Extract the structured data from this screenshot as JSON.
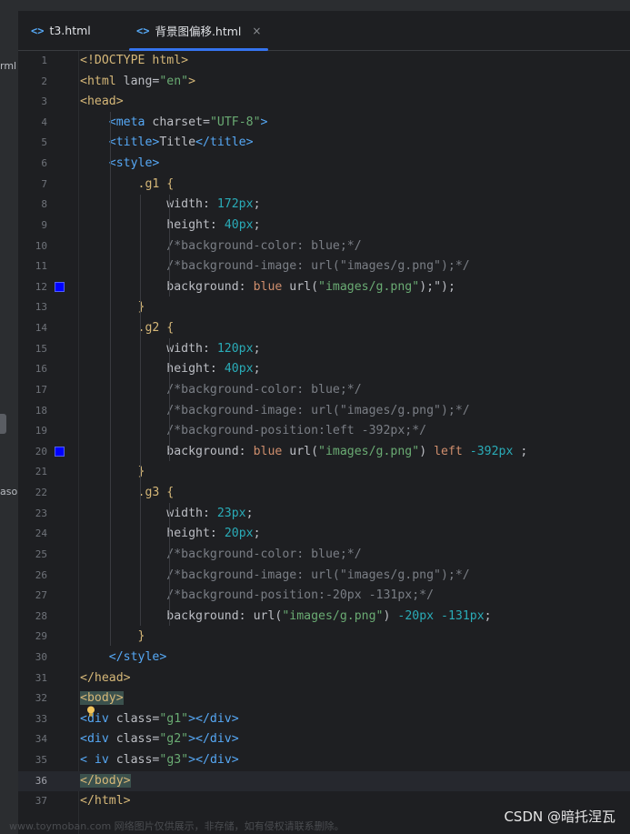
{
  "tabs": [
    {
      "label": "t3.html",
      "icon": "html-file-icon",
      "active": false
    },
    {
      "label": "背景图偏移.html",
      "icon": "html-file-icon",
      "active": true,
      "close": "×"
    }
  ],
  "tab_icon_glyph": "<>",
  "left_fragments": [
    "rml",
    "aso"
  ],
  "code_lines": [
    [
      [
        "t-tag",
        "<!DOCTYPE html>"
      ]
    ],
    [
      [
        "t-tag",
        "<html "
      ],
      [
        "t-attr",
        "lang="
      ],
      [
        "t-str",
        "\"en\""
      ],
      [
        "t-tag",
        ">"
      ]
    ],
    [
      [
        "t-tag",
        "<head>"
      ]
    ],
    [
      [
        "t-plain",
        "    "
      ],
      [
        "t-innertag",
        "<meta "
      ],
      [
        "t-attr",
        "charset="
      ],
      [
        "t-str",
        "\"UTF-8\""
      ],
      [
        "t-innertag",
        ">"
      ]
    ],
    [
      [
        "t-plain",
        "    "
      ],
      [
        "t-innertag",
        "<title>"
      ],
      [
        "t-plain",
        "Title"
      ],
      [
        "t-innertag",
        "</title>"
      ]
    ],
    [
      [
        "t-plain",
        "    "
      ],
      [
        "t-innertag",
        "<style>"
      ]
    ],
    [
      [
        "t-plain",
        "        "
      ],
      [
        "t-sel",
        ".g1 "
      ],
      [
        "t-brace",
        "{"
      ]
    ],
    [
      [
        "t-plain",
        "            "
      ],
      [
        "t-prop",
        "width: "
      ],
      [
        "t-num",
        "172px"
      ],
      [
        "t-plain",
        ";"
      ]
    ],
    [
      [
        "t-plain",
        "            "
      ],
      [
        "t-prop",
        "height: "
      ],
      [
        "t-num",
        "40px"
      ],
      [
        "t-plain",
        ";"
      ]
    ],
    [
      [
        "t-plain",
        "            "
      ],
      [
        "t-cmt",
        "/*background-color: blue;*/"
      ]
    ],
    [
      [
        "t-plain",
        "            "
      ],
      [
        "t-cmt",
        "/*background-image: url(\"images/g.png\");*/"
      ]
    ],
    [
      [
        "t-plain",
        "            "
      ],
      [
        "t-prop",
        "background: "
      ],
      [
        "t-kw",
        "blue "
      ],
      [
        "t-plain",
        "url("
      ],
      [
        "t-str",
        "\"images/g.png\""
      ],
      [
        "t-plain",
        ");\");"
      ]
    ],
    [
      [
        "t-plain",
        "        "
      ],
      [
        "t-brace",
        "}"
      ]
    ],
    [
      [
        "t-plain",
        "        "
      ],
      [
        "t-sel",
        ".g2 "
      ],
      [
        "t-brace",
        "{"
      ]
    ],
    [
      [
        "t-plain",
        "            "
      ],
      [
        "t-prop",
        "width: "
      ],
      [
        "t-num",
        "120px"
      ],
      [
        "t-plain",
        ";"
      ]
    ],
    [
      [
        "t-plain",
        "            "
      ],
      [
        "t-prop",
        "height: "
      ],
      [
        "t-num",
        "40px"
      ],
      [
        "t-plain",
        ";"
      ]
    ],
    [
      [
        "t-plain",
        "            "
      ],
      [
        "t-cmt",
        "/*background-color: blue;*/"
      ]
    ],
    [
      [
        "t-plain",
        "            "
      ],
      [
        "t-cmt",
        "/*background-image: url(\"images/g.png\");*/"
      ]
    ],
    [
      [
        "t-plain",
        "            "
      ],
      [
        "t-cmt",
        "/*background-position:left -392px;*/"
      ]
    ],
    [
      [
        "t-plain",
        "            "
      ],
      [
        "t-prop",
        "background: "
      ],
      [
        "t-kw",
        "blue "
      ],
      [
        "t-plain",
        "url("
      ],
      [
        "t-str",
        "\"images/g.png\""
      ],
      [
        "t-plain",
        ") "
      ],
      [
        "t-kw",
        "left "
      ],
      [
        "t-num",
        "-392px"
      ],
      [
        "t-plain",
        " ;"
      ]
    ],
    [
      [
        "t-plain",
        "        "
      ],
      [
        "t-brace",
        "}"
      ]
    ],
    [
      [
        "t-plain",
        "        "
      ],
      [
        "t-sel",
        ".g3 "
      ],
      [
        "t-brace",
        "{"
      ]
    ],
    [
      [
        "t-plain",
        "            "
      ],
      [
        "t-prop",
        "width: "
      ],
      [
        "t-num",
        "23px"
      ],
      [
        "t-plain",
        ";"
      ]
    ],
    [
      [
        "t-plain",
        "            "
      ],
      [
        "t-prop",
        "height: "
      ],
      [
        "t-num",
        "20px"
      ],
      [
        "t-plain",
        ";"
      ]
    ],
    [
      [
        "t-plain",
        "            "
      ],
      [
        "t-cmt",
        "/*background-color: blue;*/"
      ]
    ],
    [
      [
        "t-plain",
        "            "
      ],
      [
        "t-cmt",
        "/*background-image: url(\"images/g.png\");*/"
      ]
    ],
    [
      [
        "t-plain",
        "            "
      ],
      [
        "t-cmt",
        "/*background-position:-20px -131px;*/"
      ]
    ],
    [
      [
        "t-plain",
        "            "
      ],
      [
        "t-prop",
        "background: "
      ],
      [
        "t-plain",
        "url("
      ],
      [
        "t-str",
        "\"images/g.png\""
      ],
      [
        "t-plain",
        ") "
      ],
      [
        "t-num",
        "-20px -131px"
      ],
      [
        "t-plain",
        ";"
      ]
    ],
    [
      [
        "t-plain",
        "        "
      ],
      [
        "t-brace",
        "}"
      ]
    ],
    [
      [
        "t-plain",
        "    "
      ],
      [
        "t-innertag",
        "</style>"
      ]
    ],
    [
      [
        "t-tag",
        "</head>"
      ]
    ],
    [
      [
        "t-tag t-hl",
        "<body>"
      ]
    ],
    [
      [
        "t-innertag",
        "<div "
      ],
      [
        "t-attr",
        "class="
      ],
      [
        "t-str",
        "\"g1\""
      ],
      [
        "t-innertag",
        "></div>"
      ]
    ],
    [
      [
        "t-innertag",
        "<div "
      ],
      [
        "t-attr",
        "class="
      ],
      [
        "t-str",
        "\"g2\""
      ],
      [
        "t-innertag",
        "></div>"
      ]
    ],
    [
      [
        "t-innertag",
        "<"
      ],
      [
        "t-plain",
        " "
      ],
      [
        "t-innertag",
        "iv "
      ],
      [
        "t-attr",
        "class="
      ],
      [
        "t-str",
        "\"g3\""
      ],
      [
        "t-innertag",
        "></div>"
      ]
    ],
    [
      [
        "t-tag t-hl",
        "</body>"
      ]
    ],
    [
      [
        "t-tag",
        "</html>"
      ]
    ]
  ],
  "current_line": 36,
  "marker_lines": [
    12,
    20
  ],
  "marker_color": "#0000ff",
  "watermark": "www.toymoban.com 网络图片仅供展示，非存储，如有侵权请联系删除。",
  "credit": "CSDN @暗托涅瓦"
}
